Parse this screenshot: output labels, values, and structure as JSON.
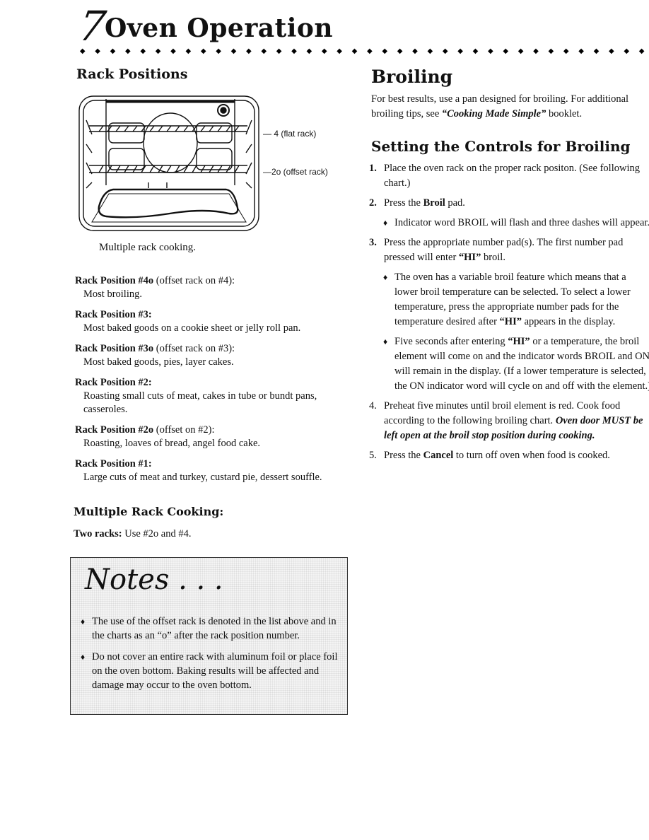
{
  "page": {
    "chapter_number": "7",
    "chapter_title": "Oven Operation",
    "diamond_count": 38
  },
  "rack_positions": {
    "heading": "Rack Positions",
    "diagram": {
      "label_top": "— 4 (flat rack)",
      "label_bottom": "—2o (offset rack)",
      "caption": "Multiple rack cooking."
    },
    "items": [
      {
        "title": "Rack Position #4o",
        "qualifier": " (offset rack on #4):",
        "description": "Most broiling."
      },
      {
        "title": "Rack Position #3:",
        "qualifier": "",
        "description": "Most baked goods on a cookie sheet or jelly roll pan."
      },
      {
        "title": "Rack Position #3o",
        "qualifier": " (offset rack on #3):",
        "description": "Most baked goods, pies, layer cakes."
      },
      {
        "title": "Rack Position #2:",
        "qualifier": "",
        "description": "Roasting small cuts of meat, cakes in tube or bundt pans, casseroles."
      },
      {
        "title": "Rack Position #2o",
        "qualifier": " (offset on #2):",
        "description": "Roasting, loaves of bread, angel food cake."
      },
      {
        "title": "Rack Position #1:",
        "qualifier": "",
        "description": "Large cuts of meat and turkey, custard pie, dessert souffle."
      }
    ],
    "multiple_heading": "Multiple Rack Cooking:",
    "two_racks_label": "Two racks:",
    "two_racks_text": " Use #2o and #4."
  },
  "notes": {
    "title": "Notes . . .",
    "bullet": "♦",
    "items": [
      "The use of the offset rack is denoted in the list above and in the charts as an “o” after the rack position number.",
      "Do not cover an entire rack with aluminum foil or place foil on the oven bottom. Baking results will be affected and damage may occur to the oven bottom."
    ]
  },
  "broiling": {
    "heading": "Broiling",
    "intro_line1": "For best results, use a pan designed for broiling. For additional",
    "intro_line2_pre": "broiling tips, see ",
    "intro_booklet": "“Cooking Made Simple”",
    "intro_line2_post": "  booklet.",
    "setting_heading": "Setting the Controls for Broiling",
    "steps": {
      "s1_num": "1.",
      "s1_text": "Place the oven rack on the proper rack positon. (See following chart.)",
      "s2_num": "2.",
      "s2_pre": "Press the ",
      "s2_bold": "Broil",
      "s2_post": " pad.",
      "s2_sub": "Indicator word BROIL will flash and three dashes will appear.",
      "s3_num": "3.",
      "s3_pre": "Press the appropriate number pad(s).  The first number pad pressed will enter ",
      "s3_bold": "“HI”",
      "s3_post": " broil.",
      "s3_sub1_pre": "The oven has a variable broil feature which means that a lower broil temperature can be selected.  To select a lower temperature, press the appropriate number pads for the temperature desired after ",
      "s3_sub1_bold": "“HI”",
      "s3_sub1_post": " appears in the display.",
      "s3_sub2_pre": "Five seconds after entering ",
      "s3_sub2_bold": "“HI”",
      "s3_sub2_post": " or a temperature, the broil element will come on and the indicator words BROIL and ON will remain in the display.  (If a lower temperature is selected, the ON indicator word will cycle on and off with the element.)",
      "s4_num": "4.",
      "s4_pre": "Preheat five minutes until broil element is red.  Cook food according to the following broiling chart.  ",
      "s4_bi": "Oven door MUST be left open at the broil stop position during cooking.",
      "s5_num": "5.",
      "s5_pre": "Press the ",
      "s5_bold": "Cancel",
      "s5_post": " to turn off oven when food is cooked."
    }
  }
}
